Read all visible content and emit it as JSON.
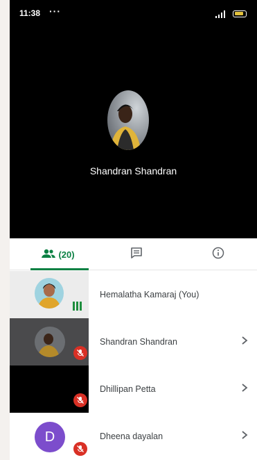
{
  "status_bar": {
    "time": "11:38",
    "more": "···"
  },
  "main_video": {
    "participant_name": "Shandran Shandran"
  },
  "tabs": {
    "people_count": "(20)"
  },
  "participants": [
    {
      "name": "Hemalatha Kamaraj (You)",
      "avatar_letter": ""
    },
    {
      "name": "Shandran Shandran",
      "avatar_letter": ""
    },
    {
      "name": "Dhillipan Petta",
      "avatar_letter": ""
    },
    {
      "name": "Dheena dayalan",
      "avatar_letter": "D"
    }
  ],
  "colors": {
    "accent_green": "#0b8043",
    "mute_red": "#d93025",
    "avatar_purple": "#7c4dcc"
  }
}
